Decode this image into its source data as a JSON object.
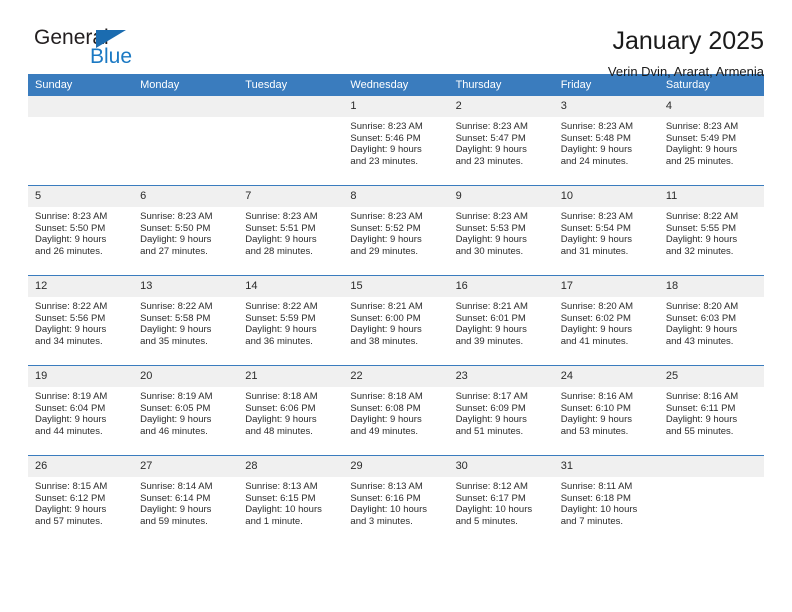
{
  "brand": {
    "name_top": "General",
    "name_bottom": "Blue",
    "accent_color": "#1b6cb0",
    "triangle_icon": "triangle-icon"
  },
  "header": {
    "title": "January 2025",
    "subtitle": "Verin Dvin, Ararat, Armenia"
  },
  "theme": {
    "header_bg": "#3a7cbe",
    "daynum_bg": "#f0f0f0",
    "row_divider": "#3a7cbe",
    "text": "#2b2b2b"
  },
  "weekdays": [
    "Sunday",
    "Monday",
    "Tuesday",
    "Wednesday",
    "Thursday",
    "Friday",
    "Saturday"
  ],
  "weeks": [
    [
      {
        "day": "",
        "empty": true
      },
      {
        "day": "",
        "empty": true
      },
      {
        "day": "",
        "empty": true
      },
      {
        "day": "1",
        "sunrise": "Sunrise: 8:23 AM",
        "sunset": "Sunset: 5:46 PM",
        "daylight1": "Daylight: 9 hours",
        "daylight2": "and 23 minutes."
      },
      {
        "day": "2",
        "sunrise": "Sunrise: 8:23 AM",
        "sunset": "Sunset: 5:47 PM",
        "daylight1": "Daylight: 9 hours",
        "daylight2": "and 23 minutes."
      },
      {
        "day": "3",
        "sunrise": "Sunrise: 8:23 AM",
        "sunset": "Sunset: 5:48 PM",
        "daylight1": "Daylight: 9 hours",
        "daylight2": "and 24 minutes."
      },
      {
        "day": "4",
        "sunrise": "Sunrise: 8:23 AM",
        "sunset": "Sunset: 5:49 PM",
        "daylight1": "Daylight: 9 hours",
        "daylight2": "and 25 minutes."
      }
    ],
    [
      {
        "day": "5",
        "sunrise": "Sunrise: 8:23 AM",
        "sunset": "Sunset: 5:50 PM",
        "daylight1": "Daylight: 9 hours",
        "daylight2": "and 26 minutes."
      },
      {
        "day": "6",
        "sunrise": "Sunrise: 8:23 AM",
        "sunset": "Sunset: 5:50 PM",
        "daylight1": "Daylight: 9 hours",
        "daylight2": "and 27 minutes."
      },
      {
        "day": "7",
        "sunrise": "Sunrise: 8:23 AM",
        "sunset": "Sunset: 5:51 PM",
        "daylight1": "Daylight: 9 hours",
        "daylight2": "and 28 minutes."
      },
      {
        "day": "8",
        "sunrise": "Sunrise: 8:23 AM",
        "sunset": "Sunset: 5:52 PM",
        "daylight1": "Daylight: 9 hours",
        "daylight2": "and 29 minutes."
      },
      {
        "day": "9",
        "sunrise": "Sunrise: 8:23 AM",
        "sunset": "Sunset: 5:53 PM",
        "daylight1": "Daylight: 9 hours",
        "daylight2": "and 30 minutes."
      },
      {
        "day": "10",
        "sunrise": "Sunrise: 8:23 AM",
        "sunset": "Sunset: 5:54 PM",
        "daylight1": "Daylight: 9 hours",
        "daylight2": "and 31 minutes."
      },
      {
        "day": "11",
        "sunrise": "Sunrise: 8:22 AM",
        "sunset": "Sunset: 5:55 PM",
        "daylight1": "Daylight: 9 hours",
        "daylight2": "and 32 minutes."
      }
    ],
    [
      {
        "day": "12",
        "sunrise": "Sunrise: 8:22 AM",
        "sunset": "Sunset: 5:56 PM",
        "daylight1": "Daylight: 9 hours",
        "daylight2": "and 34 minutes."
      },
      {
        "day": "13",
        "sunrise": "Sunrise: 8:22 AM",
        "sunset": "Sunset: 5:58 PM",
        "daylight1": "Daylight: 9 hours",
        "daylight2": "and 35 minutes."
      },
      {
        "day": "14",
        "sunrise": "Sunrise: 8:22 AM",
        "sunset": "Sunset: 5:59 PM",
        "daylight1": "Daylight: 9 hours",
        "daylight2": "and 36 minutes."
      },
      {
        "day": "15",
        "sunrise": "Sunrise: 8:21 AM",
        "sunset": "Sunset: 6:00 PM",
        "daylight1": "Daylight: 9 hours",
        "daylight2": "and 38 minutes."
      },
      {
        "day": "16",
        "sunrise": "Sunrise: 8:21 AM",
        "sunset": "Sunset: 6:01 PM",
        "daylight1": "Daylight: 9 hours",
        "daylight2": "and 39 minutes."
      },
      {
        "day": "17",
        "sunrise": "Sunrise: 8:20 AM",
        "sunset": "Sunset: 6:02 PM",
        "daylight1": "Daylight: 9 hours",
        "daylight2": "and 41 minutes."
      },
      {
        "day": "18",
        "sunrise": "Sunrise: 8:20 AM",
        "sunset": "Sunset: 6:03 PM",
        "daylight1": "Daylight: 9 hours",
        "daylight2": "and 43 minutes."
      }
    ],
    [
      {
        "day": "19",
        "sunrise": "Sunrise: 8:19 AM",
        "sunset": "Sunset: 6:04 PM",
        "daylight1": "Daylight: 9 hours",
        "daylight2": "and 44 minutes."
      },
      {
        "day": "20",
        "sunrise": "Sunrise: 8:19 AM",
        "sunset": "Sunset: 6:05 PM",
        "daylight1": "Daylight: 9 hours",
        "daylight2": "and 46 minutes."
      },
      {
        "day": "21",
        "sunrise": "Sunrise: 8:18 AM",
        "sunset": "Sunset: 6:06 PM",
        "daylight1": "Daylight: 9 hours",
        "daylight2": "and 48 minutes."
      },
      {
        "day": "22",
        "sunrise": "Sunrise: 8:18 AM",
        "sunset": "Sunset: 6:08 PM",
        "daylight1": "Daylight: 9 hours",
        "daylight2": "and 49 minutes."
      },
      {
        "day": "23",
        "sunrise": "Sunrise: 8:17 AM",
        "sunset": "Sunset: 6:09 PM",
        "daylight1": "Daylight: 9 hours",
        "daylight2": "and 51 minutes."
      },
      {
        "day": "24",
        "sunrise": "Sunrise: 8:16 AM",
        "sunset": "Sunset: 6:10 PM",
        "daylight1": "Daylight: 9 hours",
        "daylight2": "and 53 minutes."
      },
      {
        "day": "25",
        "sunrise": "Sunrise: 8:16 AM",
        "sunset": "Sunset: 6:11 PM",
        "daylight1": "Daylight: 9 hours",
        "daylight2": "and 55 minutes."
      }
    ],
    [
      {
        "day": "26",
        "sunrise": "Sunrise: 8:15 AM",
        "sunset": "Sunset: 6:12 PM",
        "daylight1": "Daylight: 9 hours",
        "daylight2": "and 57 minutes."
      },
      {
        "day": "27",
        "sunrise": "Sunrise: 8:14 AM",
        "sunset": "Sunset: 6:14 PM",
        "daylight1": "Daylight: 9 hours",
        "daylight2": "and 59 minutes."
      },
      {
        "day": "28",
        "sunrise": "Sunrise: 8:13 AM",
        "sunset": "Sunset: 6:15 PM",
        "daylight1": "Daylight: 10 hours",
        "daylight2": "and 1 minute."
      },
      {
        "day": "29",
        "sunrise": "Sunrise: 8:13 AM",
        "sunset": "Sunset: 6:16 PM",
        "daylight1": "Daylight: 10 hours",
        "daylight2": "and 3 minutes."
      },
      {
        "day": "30",
        "sunrise": "Sunrise: 8:12 AM",
        "sunset": "Sunset: 6:17 PM",
        "daylight1": "Daylight: 10 hours",
        "daylight2": "and 5 minutes."
      },
      {
        "day": "31",
        "sunrise": "Sunrise: 8:11 AM",
        "sunset": "Sunset: 6:18 PM",
        "daylight1": "Daylight: 10 hours",
        "daylight2": "and 7 minutes."
      },
      {
        "day": "",
        "empty": true
      }
    ]
  ]
}
